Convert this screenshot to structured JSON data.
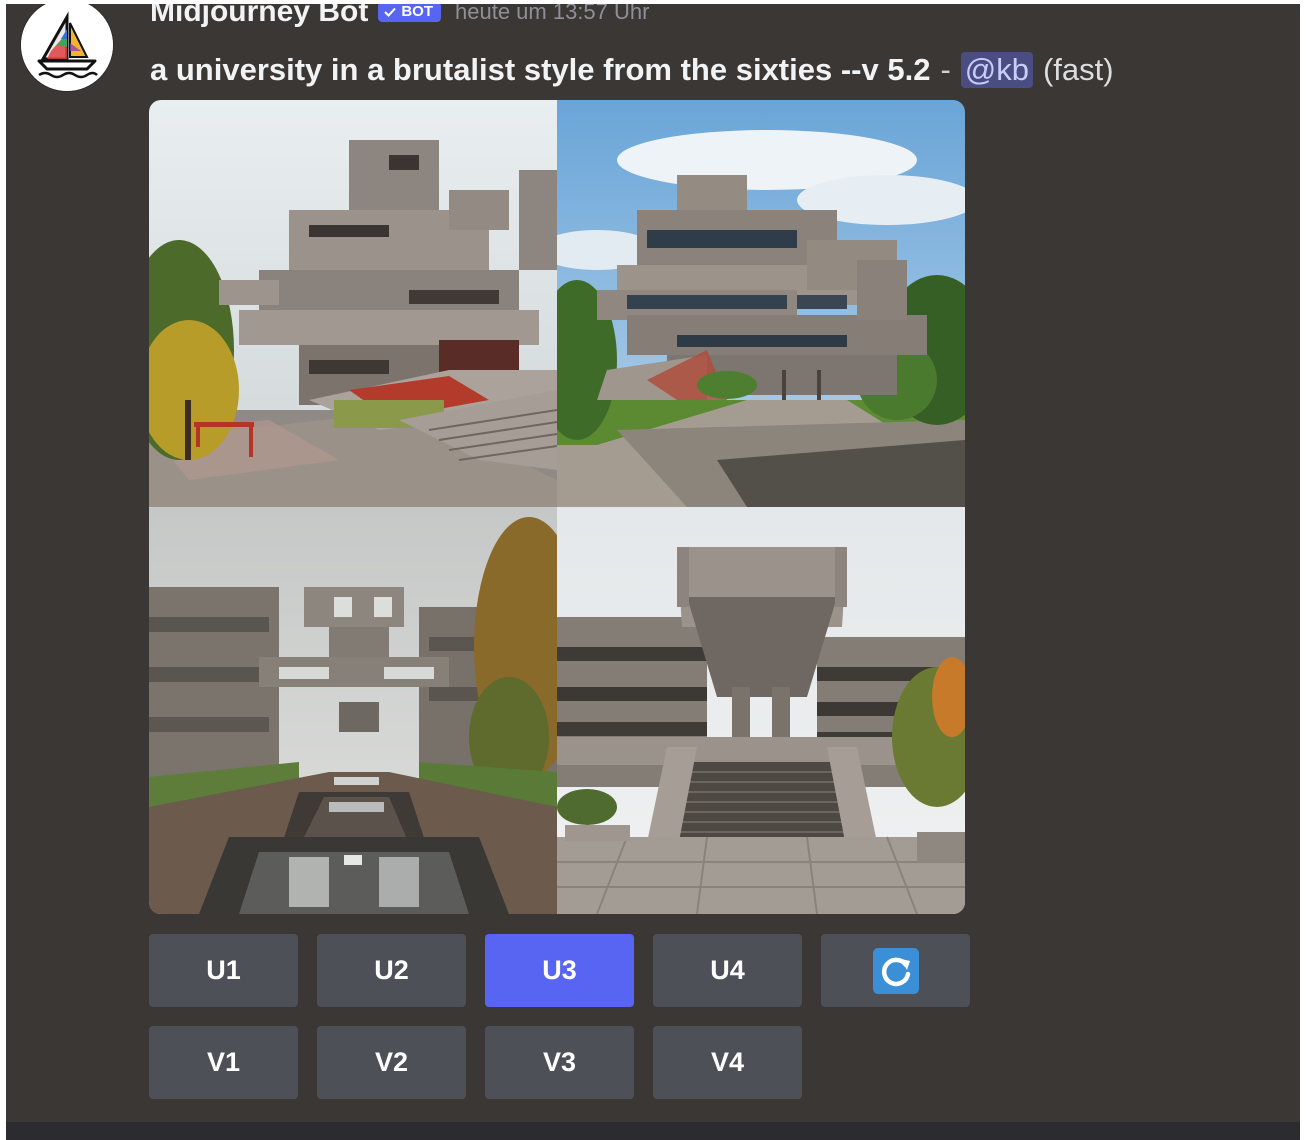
{
  "message": {
    "author": "Midjourney Bot",
    "bot_badge": "BOT",
    "timestamp": "heute um 13:57 Uhr",
    "prompt": "a university in a brutalist style from the sixties --v 5.2",
    "separator": "-",
    "mention": "@kb",
    "speed": "(fast)"
  },
  "images": [
    {
      "alt": "Brutalist concrete university building with cantilevered blocks and red railings"
    },
    {
      "alt": "Stacked brutalist concrete building under blue sky with lawn"
    },
    {
      "alt": "Brutalist campus courtyard with reflecting pool and autumn trees"
    },
    {
      "alt": "Brutalist building with central concrete canopy and wide stairs"
    }
  ],
  "buttons": {
    "upscale": [
      "U1",
      "U2",
      "U3",
      "U4"
    ],
    "variation": [
      "V1",
      "V2",
      "V3",
      "V4"
    ],
    "active": "U3",
    "reroll_icon": "refresh-icon"
  },
  "colors": {
    "background": "#3a3734",
    "button": "#4e5058",
    "button_active": "#5865f2",
    "mention_bg": "#4a4d82",
    "reroll_icon": "#3b8fd6"
  }
}
